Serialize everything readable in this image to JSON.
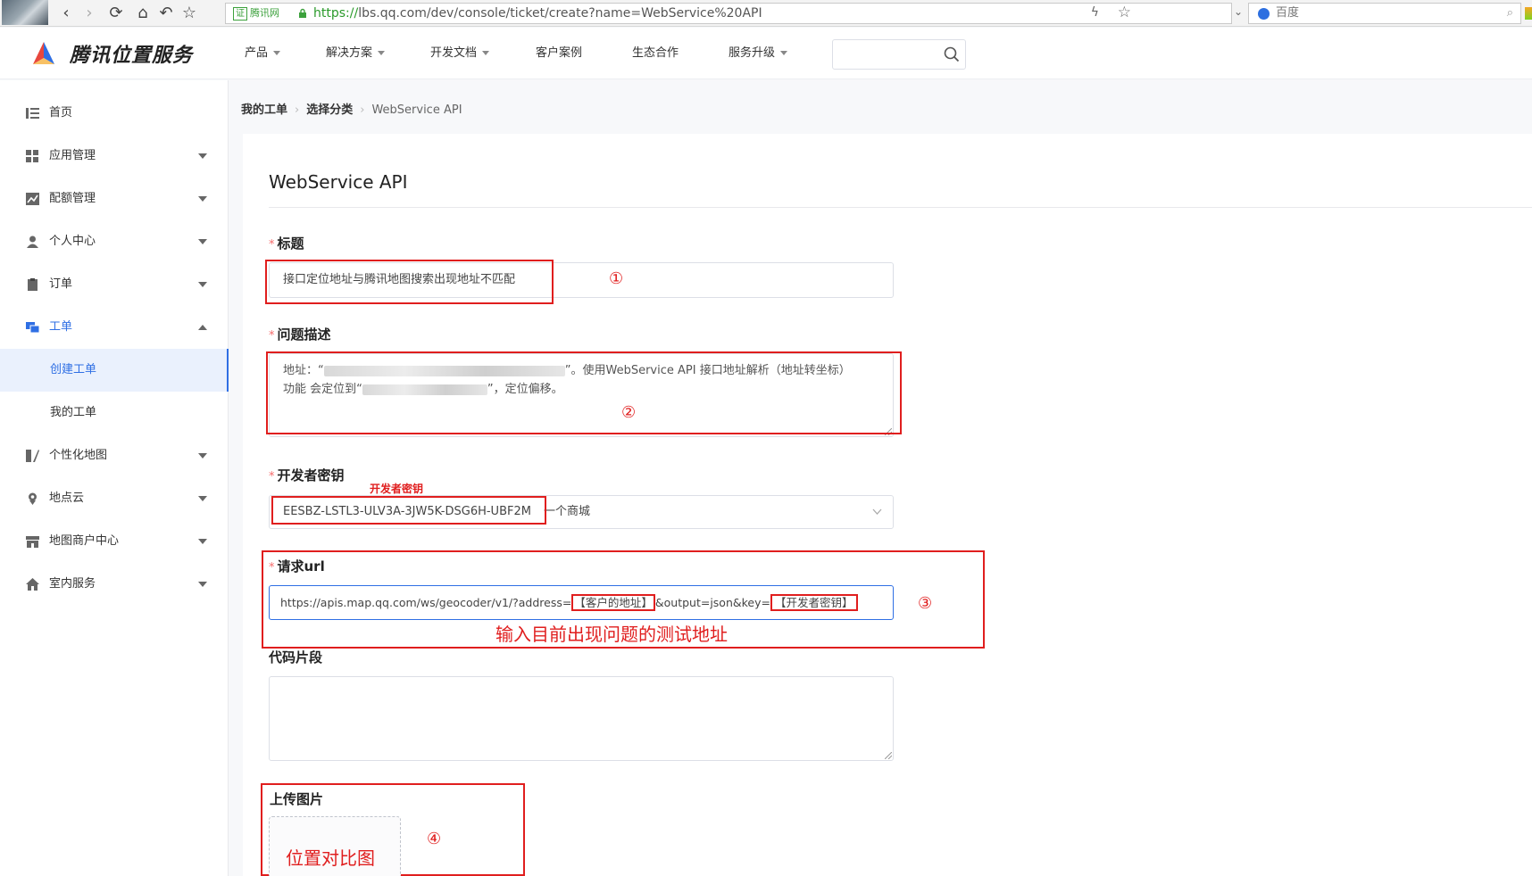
{
  "browser": {
    "cert_label": "证",
    "cert_site": "腾讯网",
    "url_scheme": "https://",
    "url_host": "lbs.qq.com",
    "url_path": "/dev/console/ticket/create?name=WebService%20API",
    "search_engine": "百度"
  },
  "header": {
    "logo_text": "腾讯位置服务",
    "nav": [
      {
        "label": "产品",
        "dropdown": true
      },
      {
        "label": "解决方案",
        "dropdown": true
      },
      {
        "label": "开发文档",
        "dropdown": true
      },
      {
        "label": "客户案例",
        "dropdown": false
      },
      {
        "label": "生态合作",
        "dropdown": false
      },
      {
        "label": "服务升级",
        "dropdown": true
      }
    ],
    "search_placeholder": ""
  },
  "sidebar": {
    "items": [
      {
        "label": "首页",
        "icon": "list-icon"
      },
      {
        "label": "应用管理",
        "icon": "apps-icon"
      },
      {
        "label": "配额管理",
        "icon": "chart-icon"
      },
      {
        "label": "个人中心",
        "icon": "user-icon"
      },
      {
        "label": "订单",
        "icon": "clipboard-icon"
      },
      {
        "label": "工单",
        "icon": "ticket-icon"
      },
      {
        "label": "个性化地图",
        "icon": "custom-map-icon"
      },
      {
        "label": "地点云",
        "icon": "location-pin-icon"
      },
      {
        "label": "地图商户中心",
        "icon": "store-icon"
      },
      {
        "label": "室内服务",
        "icon": "home-icon"
      }
    ],
    "subitems": [
      {
        "label": "创建工单"
      },
      {
        "label": "我的工单"
      }
    ],
    "active_color": "#2f6fe4"
  },
  "breadcrumb": {
    "items": [
      "我的工单",
      "选择分类",
      "WebService API"
    ]
  },
  "form": {
    "title": "WebService API",
    "required_mark": "*",
    "fields": {
      "subject": {
        "label": "标题",
        "value": "接口定位地址与腾讯地图搜索出现地址不匹配"
      },
      "description": {
        "label": "问题描述",
        "line1_prefix": "地址：“",
        "line1_suffix": "”。使用WebService API 接口地址解析（地址转坐标）",
        "line2_prefix": "功能 会定位到“",
        "line2_suffix": "”，定位偏移。"
      },
      "key": {
        "label": "开发者密钥",
        "value": "EESBZ-LSTL3-ULV3A-3JW5K-DSG6H-UBF2M",
        "app_name": "一个商城"
      },
      "url": {
        "label": "请求url",
        "part1": "https://apis.map.qq.com/ws/geocoder/v1/?address=",
        "part2": "【客户的地址】",
        "part3": "&output=json&key=",
        "part4": "【开发者密钥】"
      },
      "code": {
        "label": "代码片段",
        "value": ""
      },
      "upload": {
        "label": "上传图片"
      }
    }
  },
  "annotations": {
    "n1": "①",
    "n2": "②",
    "n3": "③",
    "n4": "④",
    "key_note": "开发者密钥",
    "url_note": "输入目前出现问题的测试地址",
    "image_note": "位置对比图",
    "color": "#e01e1e"
  }
}
